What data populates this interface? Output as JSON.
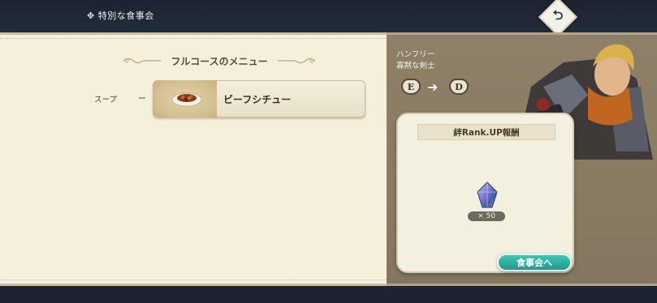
{
  "header": {
    "title": "特別な食事会",
    "title_icon": "diamond-ornament-icon",
    "back_icon": "return-arrow-icon"
  },
  "menu": {
    "heading": "フルコースのメニュー",
    "course_label": "スープ",
    "dash": "ー",
    "dish_name": "ビーフシチュー",
    "dish_icon": "beef-stew-icon"
  },
  "character": {
    "name": "ハンフリー",
    "title": "寡黙な剣士",
    "rank_from": "E",
    "rank_to": "D"
  },
  "reward": {
    "header": "絆Rank.UP報酬",
    "item_icon": "crystal-gem-icon",
    "quantity": "× 50"
  },
  "actions": {
    "dinner_button": "食事会へ"
  },
  "colors": {
    "parchment": "#f5f0dc",
    "right_panel": "#8a7c62",
    "accent_teal": "#2aa99a",
    "dark_bg": "#1a2230"
  }
}
